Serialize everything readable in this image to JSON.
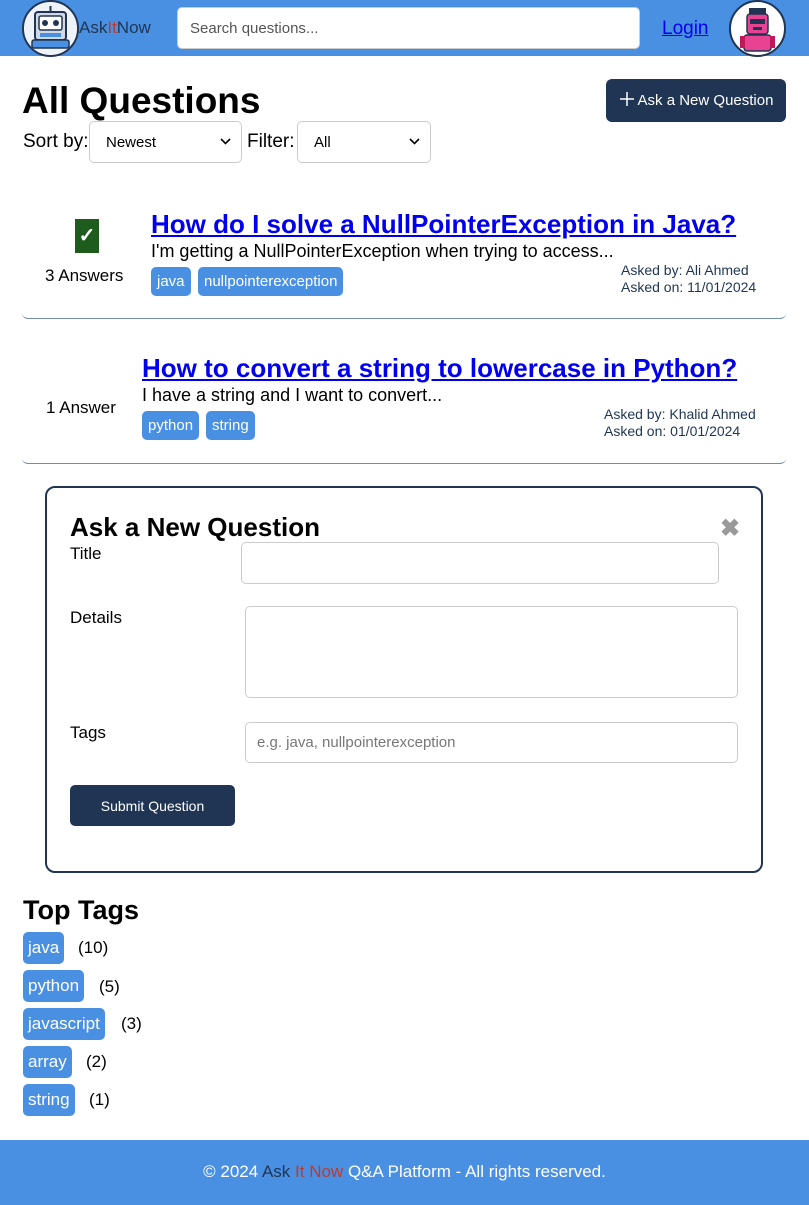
{
  "header": {
    "brand_part1": "Ask",
    "brand_part2": "It",
    "brand_part3": "Now",
    "search_placeholder": "Search questions...",
    "login_label": "Login"
  },
  "main": {
    "title": "All Questions",
    "ask_button_label": "Ask a New Question",
    "sort_label": "Sort by:",
    "sort_value": "Newest",
    "filter_label": "Filter:",
    "filter_value": "All"
  },
  "questions": [
    {
      "title": "How do I solve a NullPointerException in Java?",
      "excerpt": "I'm getting a NullPointerException when trying to access...",
      "answers": "3 Answers",
      "accepted": true,
      "tags": [
        "java",
        "nullpointerexception"
      ],
      "asked_by": "Asked by: Ali Ahmed",
      "asked_on": "Asked on: 11/01/2024"
    },
    {
      "title": "How to convert a string to lowercase in Python?",
      "excerpt": "I have a string and I want to convert...",
      "answers": "1 Answer",
      "accepted": false,
      "tags": [
        "python",
        "string"
      ],
      "asked_by": "Asked by: Khalid Ahmed",
      "asked_on": "Asked on: 01/01/2024"
    }
  ],
  "form": {
    "title": "Ask a New Question",
    "close_symbol": "✖",
    "title_label": "Title",
    "details_label": "Details",
    "tags_label": "Tags",
    "tags_placeholder": "e.g. java, nullpointerexception",
    "submit_label": "Submit Question"
  },
  "top_tags": {
    "title": "Top Tags",
    "items": [
      {
        "name": "java",
        "count": "(10)"
      },
      {
        "name": "python",
        "count": "(5)"
      },
      {
        "name": "javascript",
        "count": "(3)"
      },
      {
        "name": "array",
        "count": "(2)"
      },
      {
        "name": "string",
        "count": "(1)"
      }
    ]
  },
  "footer": {
    "prefix": "© 2024 ",
    "brand_part1": "Ask ",
    "brand_part2": "It Now",
    "suffix": " Q&A Platform - All rights reserved."
  },
  "colors": {
    "header_bg": "#4a90e2",
    "primary_dark": "#1f3553",
    "tag_bg": "#4a90e2",
    "accepted_green": "#1e5c1e",
    "brand_red": "#c0392b"
  },
  "icons": {
    "logo": "robot-logo-icon",
    "avatar": "robot-avatar-icon",
    "ask_plus": "plus-icon",
    "accepted": "checkmark-icon",
    "close": "close-icon",
    "select": "chevron-down-icon"
  }
}
